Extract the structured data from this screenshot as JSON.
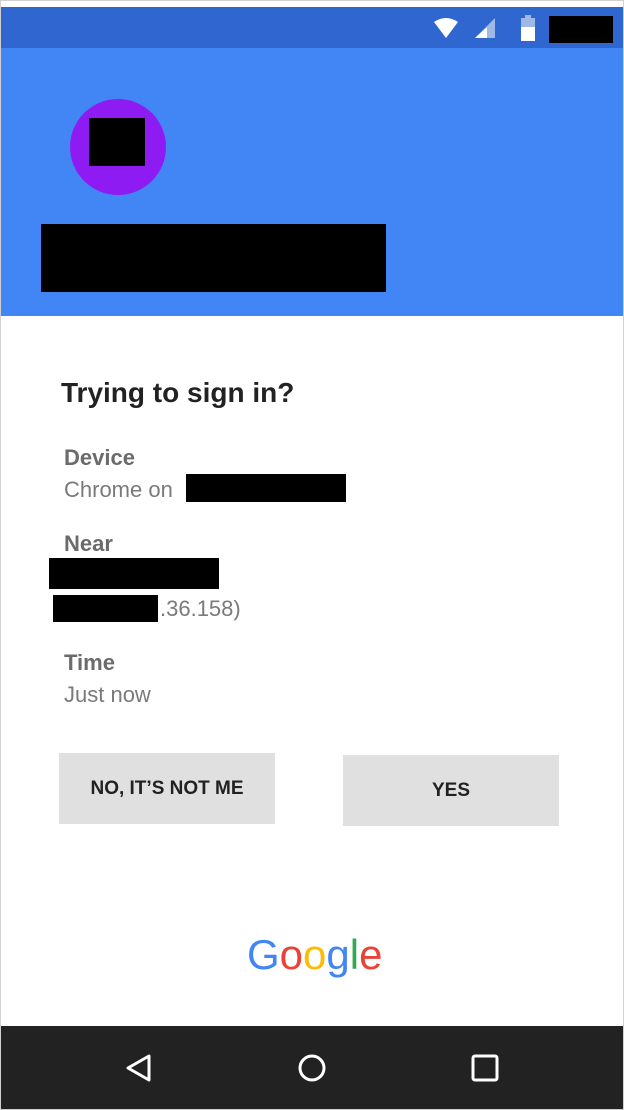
{
  "status_bar": {
    "icons": [
      "wifi-icon",
      "cell-signal-icon",
      "battery-icon"
    ],
    "background": "#2f66cf"
  },
  "header": {
    "background": "#4285f4",
    "avatar_color": "#8e1cf2"
  },
  "prompt": {
    "title": "Trying to sign in?",
    "device_label": "Device",
    "device_value": "Chrome on",
    "near_label": "Near",
    "ip_suffix": ".36.158)",
    "time_label": "Time",
    "time_value": "Just now"
  },
  "actions": {
    "deny_label": "NO, IT’S NOT ME",
    "approve_label": "YES"
  },
  "brand": {
    "letters": [
      "G",
      "o",
      "o",
      "g",
      "l",
      "e"
    ],
    "colors": [
      "#4285f4",
      "#ea4335",
      "#fbbc05",
      "#4285f4",
      "#34a853",
      "#ea4335"
    ]
  },
  "nav_bar": {
    "icons": [
      "back-icon",
      "home-icon",
      "recents-icon"
    ],
    "background": "#222222"
  }
}
